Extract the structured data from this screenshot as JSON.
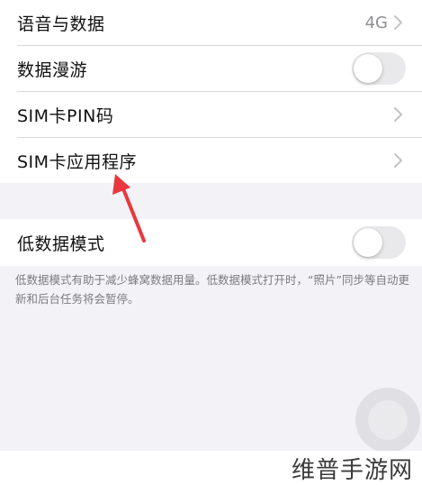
{
  "cellular": {
    "rows": [
      {
        "label": "语音与数据",
        "value": "4G",
        "control": "chevron"
      },
      {
        "label": "数据漫游",
        "control": "toggle",
        "on": false
      },
      {
        "label": "SIM卡PIN码",
        "control": "chevron"
      },
      {
        "label": "SIM卡应用程序",
        "control": "chevron"
      }
    ]
  },
  "low_data": {
    "label": "低数据模式",
    "on": false,
    "footnote": "低数据模式有助于减少蜂窝数据用量。低数据模式打开时，“照片”同步等自动更新和后台任务将会暂停。"
  },
  "watermark": "维普手游网",
  "colors": {
    "background": "#f2f2f7",
    "cell": "#ffffff",
    "secondary_text": "#8e8e93",
    "toggle_off": "#e9e9eb",
    "annotation_arrow": "#e8383d"
  },
  "icons": {
    "chevron": "chevron-right-icon",
    "arrow": "red-annotation-arrow",
    "assistive_touch": "assistive-touch-icon"
  }
}
